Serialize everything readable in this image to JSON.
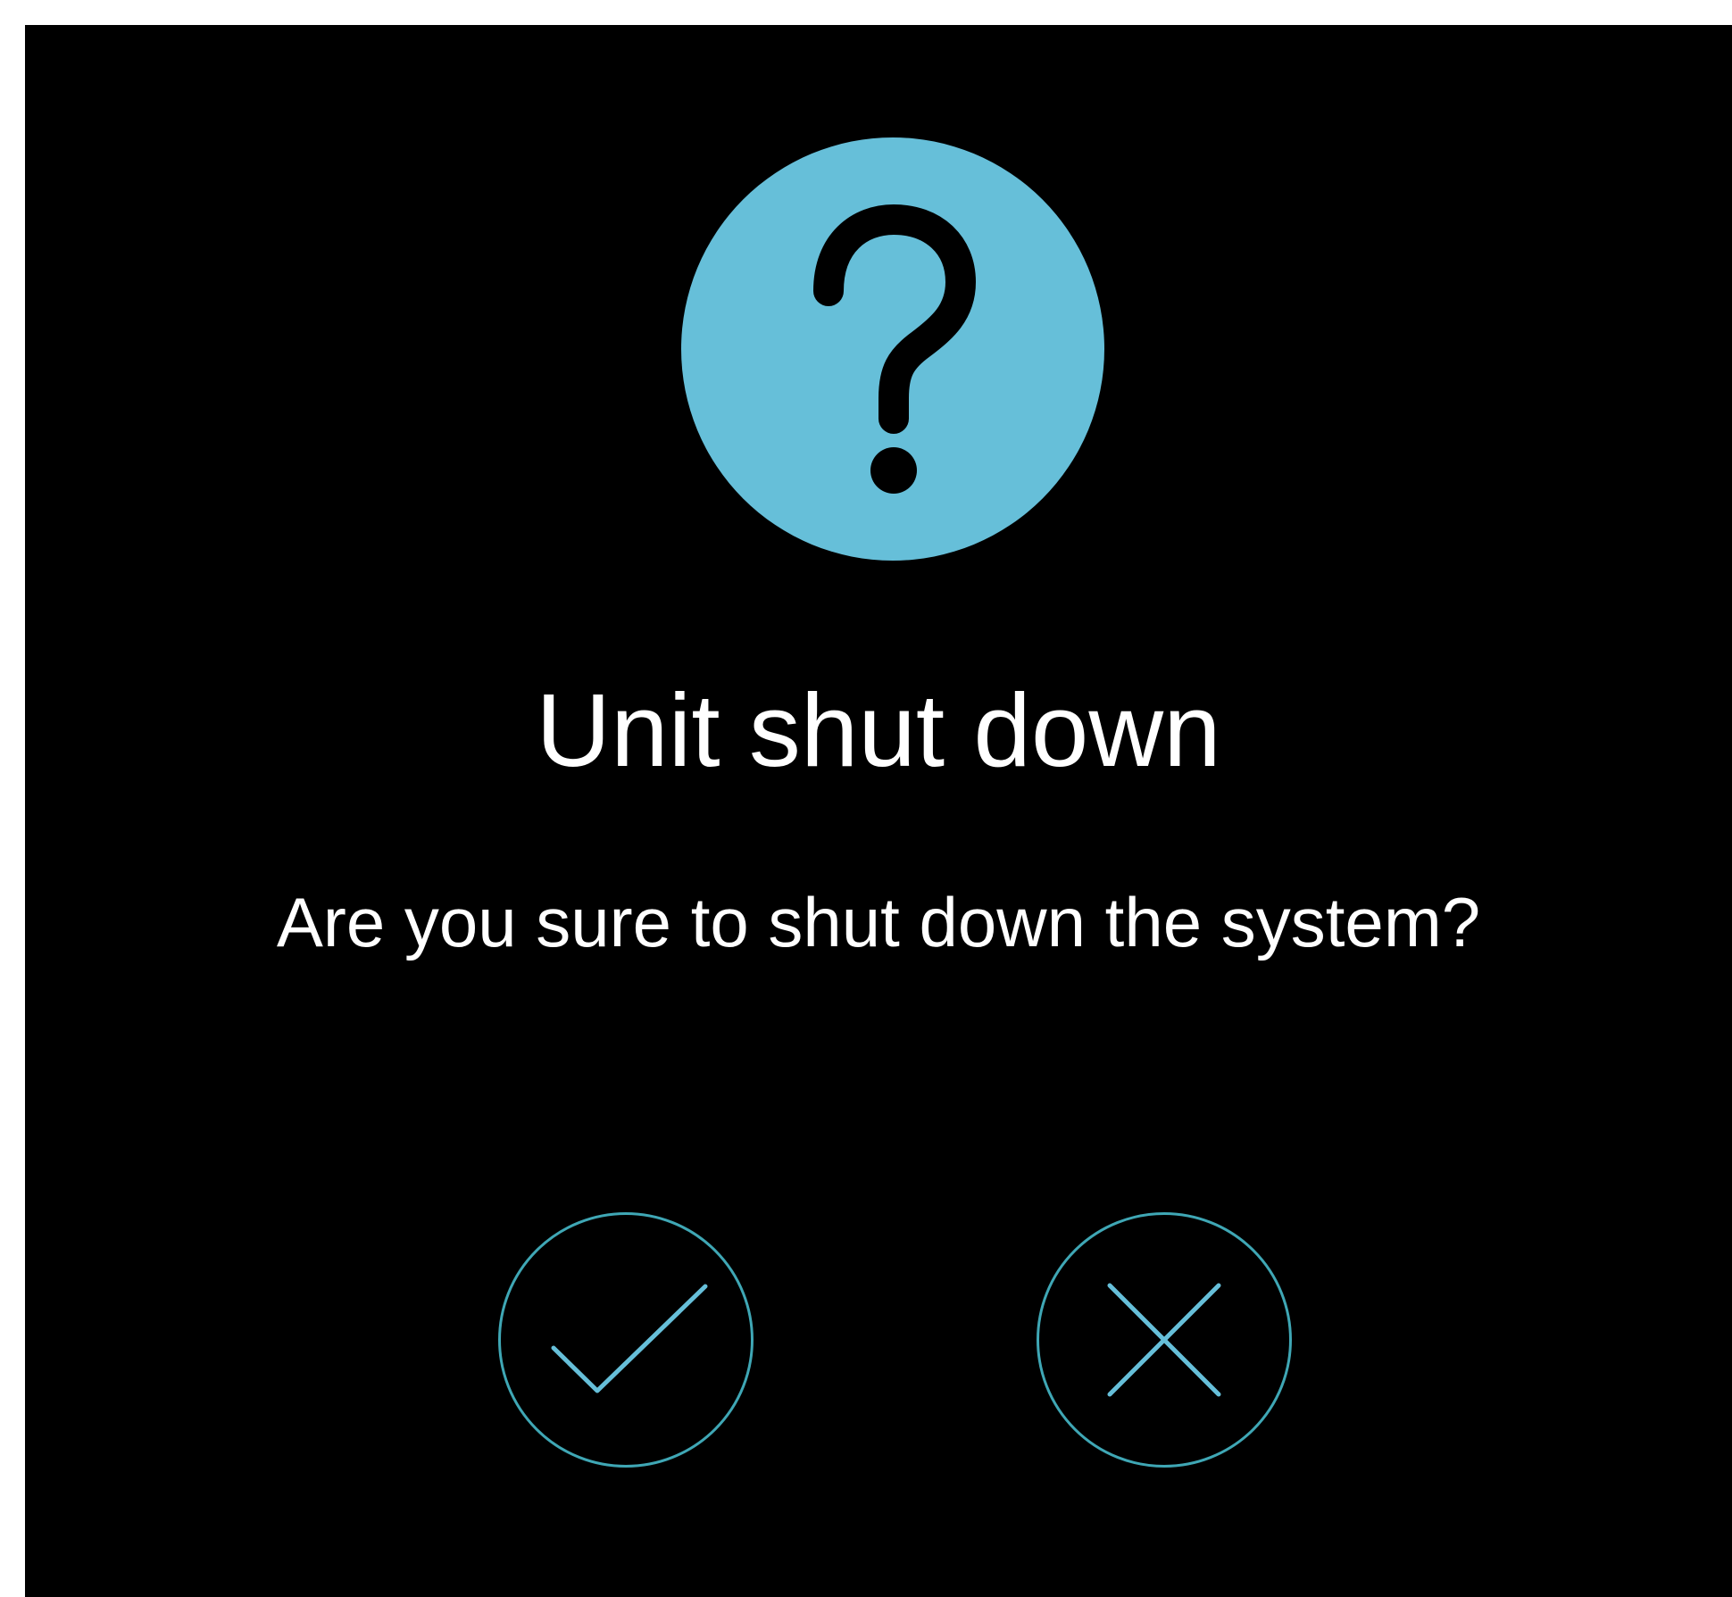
{
  "dialog": {
    "icon": "question-mark-icon",
    "title": "Unit shut down",
    "message": "Are you sure to shut down the system?",
    "confirm_icon": "checkmark-icon",
    "cancel_icon": "close-icon"
  },
  "colors": {
    "background": "#000000",
    "accent": "#66bfd9",
    "button_ring": "#3fa7b5",
    "button_glyph": "#66bfd9",
    "text": "#ffffff"
  }
}
